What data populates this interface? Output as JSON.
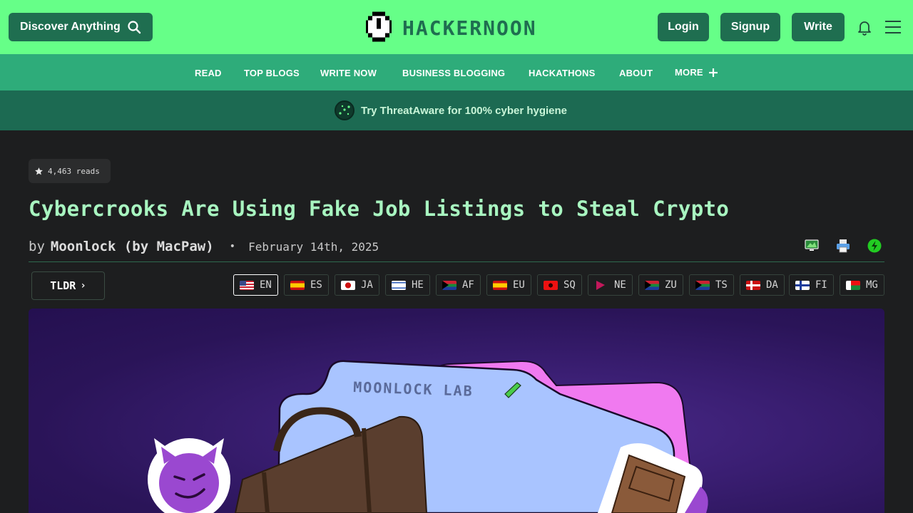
{
  "header": {
    "discover_label": "Discover Anything",
    "logo_text": "HACKERNOON",
    "login_label": "Login",
    "signup_label": "Signup",
    "write_label": "Write"
  },
  "nav": {
    "items": [
      "READ",
      "TOP BLOGS",
      "WRITE NOW",
      "BUSINESS BLOGGING",
      "HACKATHONS",
      "ABOUT",
      "MORE"
    ]
  },
  "banner": {
    "text": "Try ThreatAware for 100% cyber hygiene"
  },
  "article": {
    "reads": "4,463 reads",
    "title": "Cybercrooks Are Using Fake Job Listings to Steal Crypto",
    "by": "by",
    "author": "Moonlock (by MacPaw)",
    "separator": "•",
    "date": "February 14th, 2025",
    "tldr_label": "TLDR",
    "hero_label": "MOONLOCK LAB"
  },
  "languages": {
    "active": "EN",
    "items": [
      "EN",
      "ES",
      "JA",
      "HE",
      "AF",
      "EU",
      "SQ",
      "NE",
      "ZU",
      "TS",
      "DA",
      "FI",
      "MG"
    ]
  },
  "icons": {
    "discover": "search-icon",
    "notifications": "bell-icon",
    "menu": "hamburger-icon",
    "reads": "star-icon",
    "action1": "monitor-icon",
    "action2": "printer-icon",
    "action3": "lightning-icon"
  },
  "colors": {
    "topbar": "#66ff88",
    "nav": "#2eac7a",
    "banner": "#1c6a52",
    "button": "#1f6e50",
    "title": "#a8f5c0",
    "background": "#1d1e1f"
  }
}
